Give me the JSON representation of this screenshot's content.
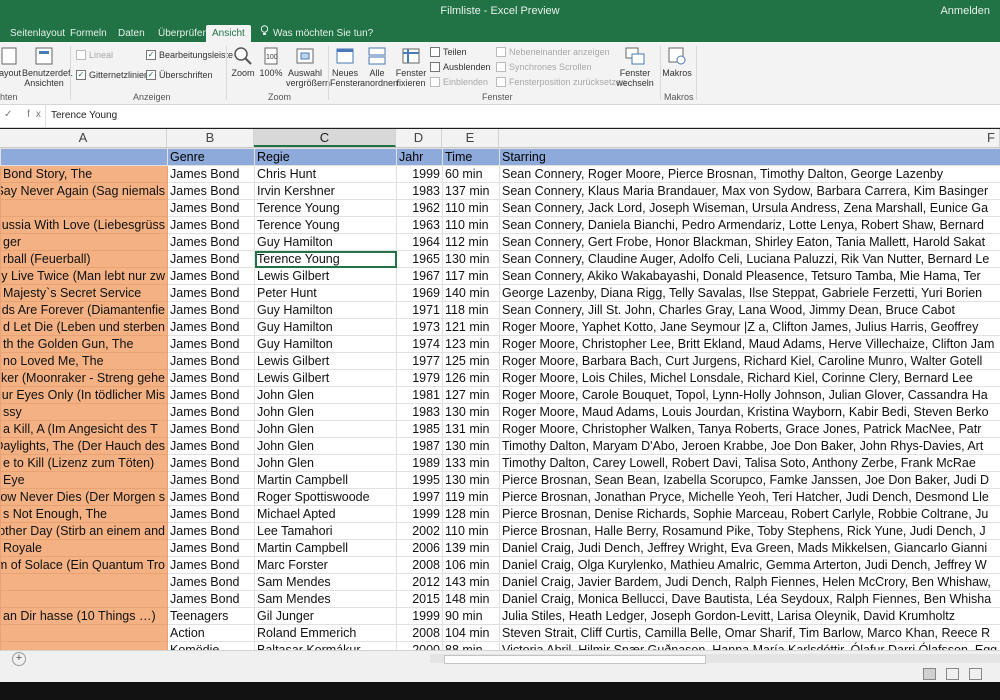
{
  "window": {
    "title": "Filmliste  -  Excel Preview",
    "signin": "Anmelden"
  },
  "tabs": [
    "Seitenlayout",
    "Formeln",
    "Daten",
    "Überprüfen",
    "Ansicht"
  ],
  "tell_me": "Was möchten Sie tun?",
  "ribbon": {
    "layout_label": "layout",
    "custom_views_label": "Benutzerdef. Ansichten",
    "views_group": "hten",
    "lineal": "Lineal",
    "gridlines": "Gitternetzlinien",
    "formula_bar": "Bearbeitungsleiste",
    "headings": "Überschriften",
    "show_group": "Anzeigen",
    "zoom": "Zoom",
    "zoom100": "100%",
    "zoom_selection": "Auswahl vergrößern",
    "zoom_group": "Zoom",
    "new_window": "Neues Fenster",
    "arrange_all": "Alle anordnen",
    "freeze": "Fenster fixieren",
    "split": "Teilen",
    "hide": "Ausblenden",
    "unhide": "Einblenden",
    "side_by_side": "Nebeneinander anzeigen",
    "sync_scroll": "Synchrones Scrollen",
    "reset_pos": "Fensterposition zurücksetzen",
    "window_group": "Fenster",
    "switch": "Fenster wechseln",
    "macros": "Makros",
    "macros_group": "Makros"
  },
  "formula": {
    "fx": "✓  fx",
    "content": "Terence Young"
  },
  "columns": [
    "A",
    "B",
    "C",
    "D",
    "E",
    "F"
  ],
  "headers": [
    "",
    "Genre",
    "Regie",
    "Jahr",
    "Time",
    "Starring"
  ],
  "rows": [
    [
      "Bond Story, The",
      "James Bond",
      "Chris Hunt",
      "1999",
      "60 min",
      "Sean Connery, Roger Moore, Pierce Brosnan, Timothy Dalton, George Lazenby"
    ],
    [
      "Say Never Again (Sag niemals",
      "James Bond",
      "Irvin Kershner",
      "1983",
      "137 min",
      "Sean Connery, Klaus Maria Brandauer, Max von Sydow, Barbara Carrera, Kim Basinger"
    ],
    [
      "",
      "James Bond",
      "Terence Young",
      "1962",
      "110 min",
      "Sean Connery, Jack Lord, Joseph Wiseman, Ursula Andress, Zena Marshall, Eunice Ga"
    ],
    [
      "ussia With Love (Liebesgrüss",
      "James Bond",
      "Terence Young",
      "1963",
      "110 min",
      "Sean Connery, Daniela Bianchi, Pedro Armendariz, Lotte Lenya, Robert Shaw, Bernard"
    ],
    [
      "ger",
      "James Bond",
      "Guy Hamilton",
      "1964",
      "112 min",
      "Sean Connery, Gert Frobe, Honor Blackman, Shirley Eaton, Tania Mallett, Harold Sakat"
    ],
    [
      "rball (Feuerball)",
      "James Bond",
      "Terence Young",
      "1965",
      "130 min",
      "Sean Connery, Claudine Auger, Adolfo Celi, Luciana Paluzzi, Rik Van Nutter, Bernard Le"
    ],
    [
      "ly Live Twice (Man lebt nur zw",
      "James Bond",
      "Lewis Gilbert",
      "1967",
      "117 min",
      "Sean Connery, Akiko Wakabayashi, Donald Pleasence, Tetsuro Tamba, Mie Hama, Ter"
    ],
    [
      "Majesty`s Secret Service",
      "James Bond",
      "Peter Hunt",
      "1969",
      "140 min",
      "George Lazenby, Diana Rigg, Telly Savalas, Ilse Steppat, Gabriele Ferzetti, Yuri Borien"
    ],
    [
      "ds Are Forever (Diamantenfie",
      "James Bond",
      "Guy Hamilton",
      "1971",
      "118 min",
      "Sean Connery, Jill St. John, Charles Gray, Lana Wood, Jimmy Dean, Bruce Cabot"
    ],
    [
      "d Let Die (Leben und sterben",
      "James Bond",
      "Guy Hamilton",
      "1973",
      "121 min",
      "Roger Moore, Yaphet Kotto, Jane Seymour |Z a, Clifton James, Julius Harris, Geoffrey"
    ],
    [
      "th the Golden Gun, The",
      "James Bond",
      "Guy Hamilton",
      "1974",
      "123 min",
      "Roger Moore, Christopher Lee, Britt Ekland, Maud Adams, Herve Villechaize, Clifton Jam"
    ],
    [
      "no Loved Me, The",
      "James Bond",
      "Lewis Gilbert",
      "1977",
      "125 min",
      "Roger Moore, Barbara Bach, Curt Jurgens, Richard Kiel, Caroline Munro, Walter Gotell"
    ],
    [
      "ker (Moonraker - Streng gehe",
      "James Bond",
      "Lewis Gilbert",
      "1979",
      "126 min",
      "Roger Moore, Lois Chiles, Michel Lonsdale, Richard Kiel, Corinne Clery, Bernard Lee"
    ],
    [
      "ur Eyes Only (In tödlicher Mis",
      "James Bond",
      "John Glen",
      "1981",
      "127 min",
      "Roger Moore, Carole Bouquet, Topol, Lynn-Holly Johnson, Julian Glover, Cassandra Ha"
    ],
    [
      "ssy",
      "James Bond",
      "John Glen",
      "1983",
      "130 min",
      "Roger Moore, Maud Adams, Louis Jourdan, Kristina Wayborn, Kabir Bedi, Steven Berko"
    ],
    [
      "a Kill, A (Im Angesicht des T",
      "James Bond",
      "John Glen",
      "1985",
      "131 min",
      "Roger Moore, Christopher Walken, Tanya Roberts, Grace Jones, Patrick MacNee, Patr"
    ],
    [
      "Daylights, The (Der Hauch des",
      "James Bond",
      "John Glen",
      "1987",
      "130 min",
      "Timothy Dalton, Maryam D'Abo, Jeroen Krabbe, Joe Don Baker, John Rhys-Davies, Art"
    ],
    [
      "e to Kill (Lizenz zum Töten)",
      "James Bond",
      "John Glen",
      "1989",
      "133 min",
      "Timothy Dalton, Carey Lowell, Robert Davi, Talisa Soto, Anthony Zerbe, Frank McRae"
    ],
    [
      "Eye",
      "James Bond",
      "Martin Campbell",
      "1995",
      "130 min",
      "Pierce Brosnan, Sean Bean, Izabella Scorupco, Famke Janssen, Joe Don Baker, Judi D"
    ],
    [
      "ow Never Dies (Der Morgen s",
      "James Bond",
      "Roger Spottiswoode",
      "1997",
      "119 min",
      "Pierce Brosnan, Jonathan Pryce, Michelle Yeoh, Teri Hatcher, Judi Dench, Desmond Lle"
    ],
    [
      "s Not Enough, The",
      "James Bond",
      "Michael Apted",
      "1999",
      "128 min",
      "Pierce Brosnan, Denise Richards, Sophie Marceau, Robert Carlyle, Robbie Coltrane, Ju"
    ],
    [
      "other Day (Stirb an einem and",
      "James Bond",
      "Lee Tamahori",
      "2002",
      "110 min",
      "Pierce Brosnan, Halle Berry, Rosamund Pike, Toby Stephens, Rick Yune, Judi Dench, J"
    ],
    [
      "Royale",
      "James Bond",
      "Martin Campbell",
      "2006",
      "139 min",
      "Daniel Craig, Judi Dench, Jeffrey Wright, Eva Green, Mads Mikkelsen, Giancarlo Gianni"
    ],
    [
      "m of Solace (Ein Quantum Tro",
      "James Bond",
      "Marc Forster",
      "2008",
      "106 min",
      "Daniel Craig, Olga Kurylenko, Mathieu Amalric, Gemma Arterton, Judi Dench, Jeffrey W"
    ],
    [
      "",
      "James Bond",
      "Sam Mendes",
      "2012",
      "143 min",
      "Daniel Craig, Javier Bardem, Judi Dench, Ralph Fiennes, Helen McCrory, Ben Whishaw,"
    ],
    [
      "",
      "James Bond",
      "Sam Mendes",
      "2015",
      "148 min",
      "Daniel Craig, Monica Bellucci, Dave Bautista, Léa Seydoux, Ralph Fiennes, Ben Whisha"
    ],
    [
      "an Dir hasse (10 Things …)",
      "Teenagers",
      "Gil Junger",
      "1999",
      "90 min",
      "Julia Stiles, Heath Ledger, Joseph Gordon-Levitt, Larisa Oleynik, David Krumholtz"
    ],
    [
      "",
      "Action",
      "Roland Emmerich",
      "2008",
      "104 min",
      "Steven Strait, Cliff Curtis, Camilla Belle, Omar Sharif, Tim Barlow, Marco Khan, Reece R"
    ],
    [
      "",
      "Komödie",
      "Baltasar Kormákur",
      "2000",
      "88 min",
      "Victoria Abril, Hilmir Snær Guðnason, Hanna María Karlsdóttir, Ólafur Darri Ólafsson, Egg"
    ]
  ],
  "active_cell": {
    "row": 5,
    "col": 2
  },
  "accent": "#217346",
  "header_color": "#8eaadb",
  "title_col_color": "#f4b183"
}
